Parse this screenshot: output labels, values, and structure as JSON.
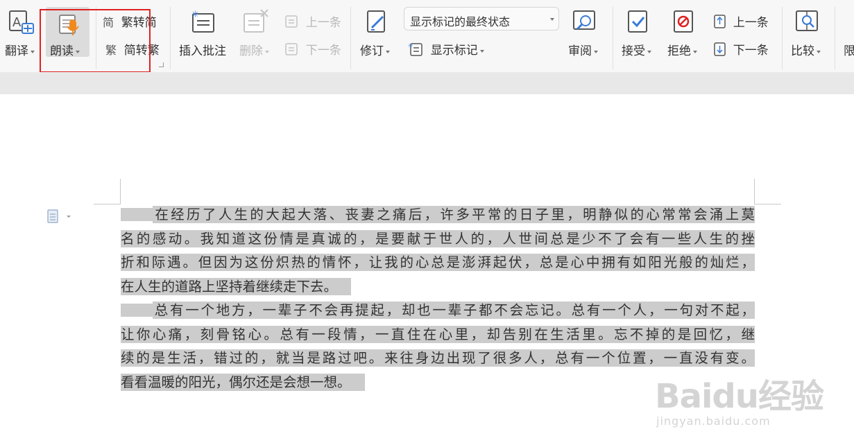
{
  "toolbar": {
    "translate": "翻译",
    "read_aloud": "朗读",
    "trad_to_simp": "繁转简",
    "simp_to_trad": "简转繁",
    "trad_icon_char": "简",
    "simp_icon_char": "繁",
    "insert_comment": "插入批注",
    "delete": "删除",
    "prev_comment": "上一条",
    "next_comment": "下一条",
    "track_changes": "修订",
    "markup_mode": "显示标记的最终状态",
    "show_markup": "显示标记",
    "review": "审阅",
    "accept": "接受",
    "reject": "拒绝",
    "prev_change": "上一条",
    "next_change": "下一条",
    "compare": "比较",
    "restrict_partial": "限"
  },
  "document": {
    "paragraph1": [
      "在经历了人生的大起大落、丧妻之痛后，许多平常的日子里，明静似的心常常会涌上莫",
      "名的感动。我知道这份情是真诚的，是要献于世人的，人世间总是少不了会有一些人生的挫",
      "折和际遇。但因为这份炽热的情怀，让我的心总是澎湃起伏，总是心中拥有如阳光般的灿烂，",
      "在人生的道路上坚持着继续走下去。"
    ],
    "paragraph2": [
      "总有一个地方，一辈子不会再提起，却也一辈子都不会忘记。总有一个人，一句对不起，",
      "让你心痛，刻骨铭心。总有一段情，一直住在心里，却告别在生活里。忘不掉的是回忆，继",
      "续的是生活，错过的，就当是路过吧。来往身边出现了很多人，总有一个位置，一直没有变。",
      "看看温暖的阳光，偶尔还是会想一想。"
    ]
  },
  "watermark": {
    "main": "Baidu经验",
    "sub": "jingyan.baidu.com"
  },
  "colors": {
    "highlight_box": "#e02020",
    "selection": "#cccccc",
    "ribbon_bg": "#f7f7f7"
  }
}
